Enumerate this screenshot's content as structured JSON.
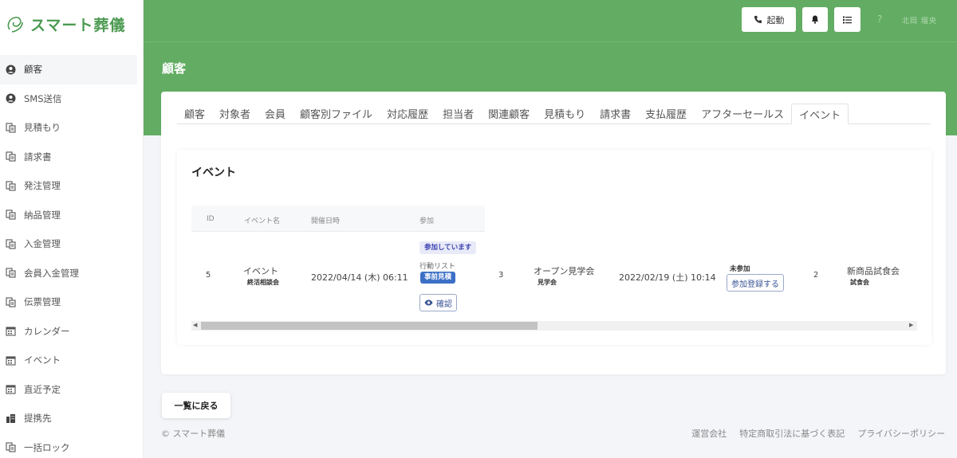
{
  "app": {
    "name": "スマート葬儀"
  },
  "sidebar": {
    "items": [
      {
        "label": "顧客",
        "icon": "user-icon"
      },
      {
        "label": "SMS送信",
        "icon": "user-icon"
      },
      {
        "label": "見積もり",
        "icon": "document-icon"
      },
      {
        "label": "請求書",
        "icon": "document-icon"
      },
      {
        "label": "発注管理",
        "icon": "document-icon"
      },
      {
        "label": "納品管理",
        "icon": "document-icon"
      },
      {
        "label": "入金管理",
        "icon": "document-icon"
      },
      {
        "label": "会員入金管理",
        "icon": "document-icon"
      },
      {
        "label": "伝票管理",
        "icon": "document-icon"
      },
      {
        "label": "カレンダー",
        "icon": "calendar-icon"
      },
      {
        "label": "イベント",
        "icon": "calendar-icon"
      },
      {
        "label": "直近予定",
        "icon": "calendar-icon"
      },
      {
        "label": "提携先",
        "icon": "building-icon"
      },
      {
        "label": "一括ロック",
        "icon": "document-icon"
      }
    ]
  },
  "topbar": {
    "call_label": "起動",
    "help": "?",
    "user_name": "北岡 瑠央"
  },
  "page": {
    "title": "顧客"
  },
  "tabs": [
    "顧客",
    "対象者",
    "会員",
    "顧客別ファイル",
    "対応履歴",
    "担当者",
    "関連顧客",
    "見積もり",
    "請求書",
    "支払履歴",
    "アフターセールス",
    "イベント"
  ],
  "events": {
    "title": "イベント",
    "headers": {
      "id": "ID",
      "name": "イベント名",
      "date": "開催日時",
      "join": "参加"
    },
    "row": {
      "id": "5",
      "name": "イベント",
      "name_sub": "終活相談会",
      "date": "2022/04/14 (木) 06:11",
      "status": "参加しています",
      "action_list_label": "行動リスト",
      "action_tag": "事前見積",
      "confirm_label": "確認",
      "col5": "3",
      "event2_name": "オープン見学会",
      "event2_sub": "見学会",
      "event2_date": "2022/02/19 (土) 10:14",
      "event2_status": "未参加",
      "register_label": "参加登録する",
      "col10": "2",
      "event3_name": "新商品試食会",
      "event3_sub": "試食会"
    }
  },
  "back_label": "一覧に戻る",
  "footer": {
    "copyright": "© スマート葬儀",
    "links": [
      "運営会社",
      "特定商取引法に基づく表記",
      "プライバシーポリシー"
    ]
  },
  "colors": {
    "brand_green": "#62ad63",
    "accent_blue": "#3c70c6"
  }
}
